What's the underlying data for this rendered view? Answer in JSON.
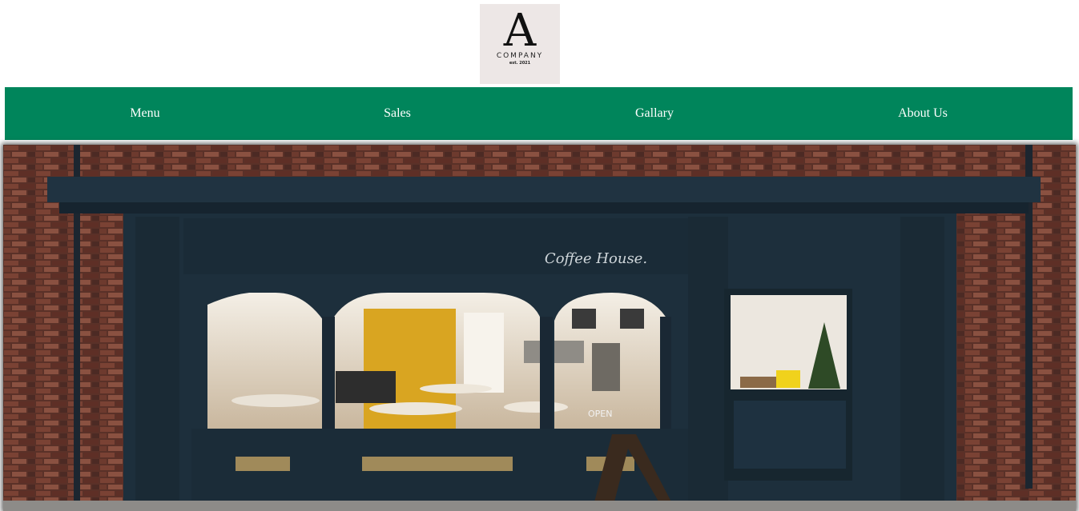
{
  "logo": {
    "letter": "A",
    "name": "COMPANY",
    "est": "est. 2021"
  },
  "nav": {
    "items": [
      {
        "label": "Menu"
      },
      {
        "label": "Sales"
      },
      {
        "label": "Gallary"
      },
      {
        "label": "About Us"
      }
    ],
    "background": "#00855b"
  },
  "hero": {
    "sign_text": "Coffee House.",
    "board_text": "OPEN",
    "colors": {
      "facade": "#1d2f3c",
      "brick": "#6b3b2e",
      "accent_wall": "#d9a521"
    }
  }
}
